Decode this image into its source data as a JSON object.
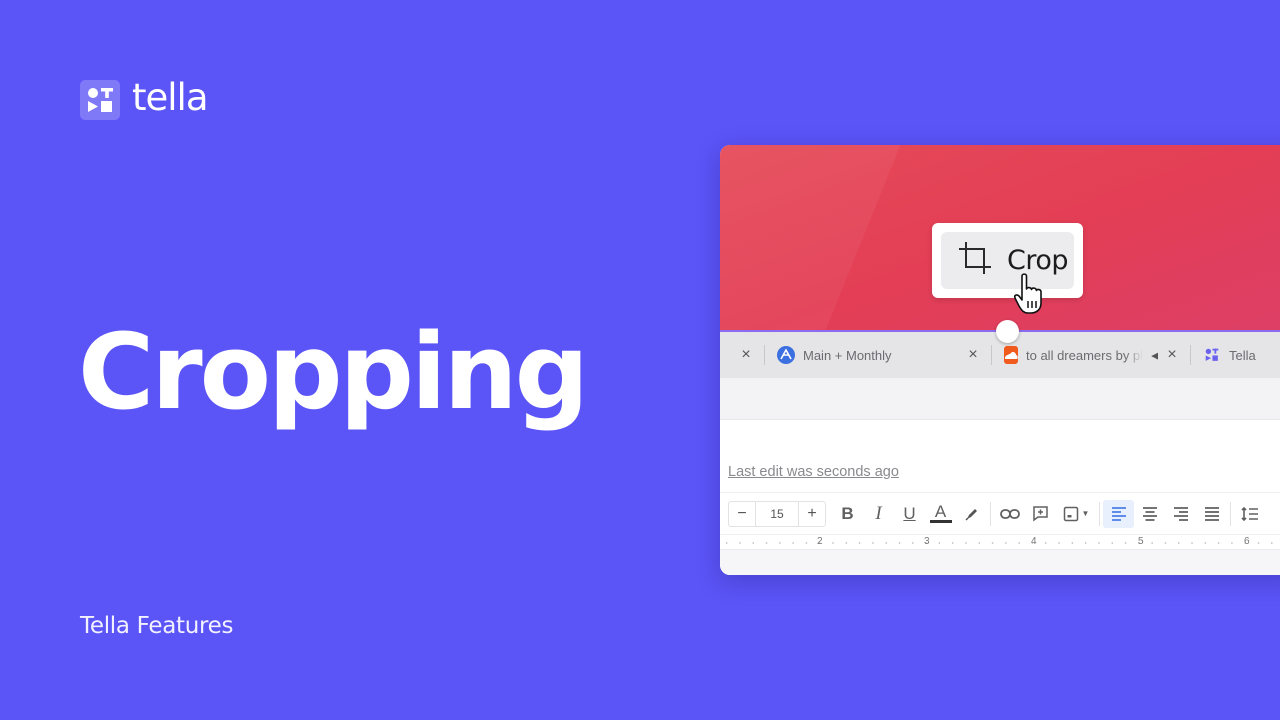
{
  "brand": {
    "name": "tella",
    "logo_icon": "tella-logo-icon"
  },
  "headline": "Cropping",
  "subtitle": "Tella Features",
  "colors": {
    "background": "#5b54f7",
    "hero_red": "#e33e55",
    "active_align": "#4a80e8"
  },
  "screenshot": {
    "crop_button": {
      "label": "Crop",
      "icon": "crop-icon",
      "cursor": "hand-pointer-icon"
    },
    "tabs": [
      {
        "label": "",
        "favicon": "none",
        "closable": true
      },
      {
        "label": "Main + Monthly",
        "favicon": "a-circle-icon",
        "closable": true
      },
      {
        "label": "to all dreamers by pl",
        "favicon": "soundcloud-icon",
        "muted_icon": "speaker-icon",
        "closable": true
      },
      {
        "label": "Tella",
        "favicon": "tella-favicon"
      }
    ],
    "last_edit": "Last edit was seconds ago",
    "toolbar": {
      "font_size_decrease": "−",
      "font_size": "15",
      "font_size_increase": "+",
      "bold": "B",
      "italic": "I",
      "underline": "U",
      "text_color": "A"
    },
    "ruler_numbers": [
      "2",
      "3",
      "4",
      "5",
      "6"
    ]
  }
}
